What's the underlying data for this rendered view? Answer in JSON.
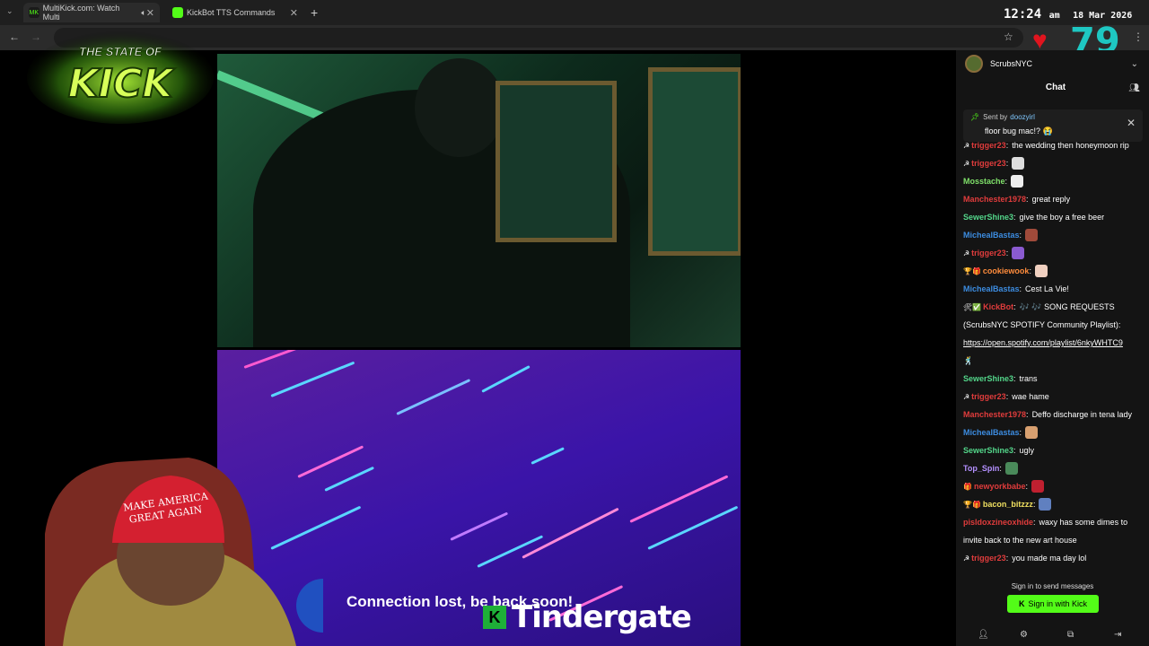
{
  "browser": {
    "tabs": [
      {
        "title": "MultiKick.com: Watch Multi",
        "favicon": "MK"
      },
      {
        "title": "KickBot TTS Commands"
      }
    ],
    "clock": {
      "time": "12:24",
      "ampm": "am",
      "date": "18 Mar 2026"
    }
  },
  "overlay": {
    "logo_line1": "THE STATE OF",
    "logo_line2": "KICK",
    "viewer_count": "79",
    "connection_text": "Connection lost, be back soon!",
    "channel_badge": "K",
    "channel_name": "Tindergate"
  },
  "chat": {
    "streamer": "ScrubsNYC",
    "title": "Chat",
    "pinned": {
      "sent_by_label": "Sent by",
      "sent_by_user": "doozyirl",
      "message": "floor bug mac!? 😭"
    },
    "messages": [
      {
        "user": "trigger23",
        "color": "#e03c3c",
        "badge": "☭",
        "text": "the wedding then honeymoon rip"
      },
      {
        "user": "trigger23",
        "color": "#e03c3c",
        "badge": "☭",
        "emote": "#ddd"
      },
      {
        "user": "Mosstache",
        "color": "#7fe06a",
        "emote": "#eee"
      },
      {
        "user": "Manchester1978",
        "color": "#e03c3c",
        "text": "great reply"
      },
      {
        "user": "SewerShine3",
        "color": "#53d68a",
        "text": "give the boy a free beer"
      },
      {
        "user": "MichealBastas",
        "color": "#3c8ce0",
        "emote": "#a04a3a"
      },
      {
        "user": "trigger23",
        "color": "#e03c3c",
        "badge": "☭",
        "emote": "#8a5ad0"
      },
      {
        "user": "cookiewook",
        "color": "#ff8c3c",
        "badge": "🏆🎁",
        "emote": "#f0d0c0"
      },
      {
        "user": "MichealBastas",
        "color": "#3c8ce0",
        "text": "Cest La Vie!"
      },
      {
        "user": "KickBot",
        "color": "#e03c3c",
        "badge": "🛠✅",
        "text": "🎶 🎶 SONG REQUESTS"
      },
      {
        "text": "(ScrubsNYC SPOTIFY Community Playlist):"
      },
      {
        "link": "https://open.spotify.com/playlist/6nkyWHTC9"
      },
      {
        "text": "🕺"
      },
      {
        "user": "SewerShine3",
        "color": "#53d68a",
        "text": "trans"
      },
      {
        "user": "trigger23",
        "color": "#e03c3c",
        "badge": "☭",
        "text": "wae hame"
      },
      {
        "user": "Manchester1978",
        "color": "#e03c3c",
        "text": "Deffo discharge in tena lady"
      },
      {
        "user": "MichealBastas",
        "color": "#3c8ce0",
        "emote": "#d8a070"
      },
      {
        "user": "SewerShine3",
        "color": "#53d68a",
        "text": "ugly"
      },
      {
        "user": "Top_Spin",
        "color": "#b490ff",
        "emote": "#4a8a5a"
      },
      {
        "user": "newyorkbabe",
        "color": "#e03c3c",
        "badge": "🎁",
        "emote": "#c02030"
      },
      {
        "user": "bacon_bitzzz",
        "color": "#f0e060",
        "badge": "🏆🎁",
        "emote": "#6080c0"
      },
      {
        "user": "pisldoxzineoxhide",
        "color": "#e03c3c",
        "text": "waxy has some dimes to"
      },
      {
        "text": "invite back to the new art house"
      },
      {
        "user": "trigger23",
        "color": "#e03c3c",
        "badge": "☭",
        "text": "you made ma day lol"
      }
    ],
    "signin_note": "Sign in to send messages",
    "signin_button": "Sign in with Kick"
  }
}
